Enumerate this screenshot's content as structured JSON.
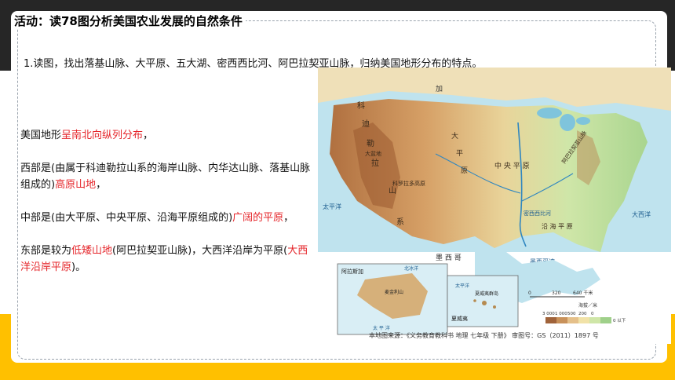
{
  "slide": {
    "title": "活动：读78图分析美国农业发展的自然条件",
    "question": "1.读图，找出落基山脉、大平原、五大湖、密西西比河、阿巴拉契亚山脉，归纳美国地形分布的特点。",
    "answer": {
      "p1": {
        "a": "美国地形",
        "b": "呈南北向纵列分布",
        "c": "，"
      },
      "p2": {
        "a": "西部是(由属于科迪勒拉山系的海岸山脉、内华达山脉、落基山脉组成的)",
        "b": "高原山地",
        "c": "，"
      },
      "p3": {
        "a": "中部是(由大平原、中央平原、沿海平原组成的)",
        "b": "广阔的平原",
        "c": "，"
      },
      "p4": {
        "a": "东部是较为",
        "b": "低矮山地",
        "c": "(阿巴拉契亚山脉)，大西洋沿岸为平原(",
        "d": "大西洋沿岸平原",
        "e": ")。"
      }
    }
  },
  "map": {
    "labels": {
      "canada": "加",
      "ke": "科",
      "di": "迪",
      "le": "勒",
      "la": "拉",
      "shan": "山",
      "xi": "系",
      "da": "大",
      "ping": "平",
      "yuan": "原",
      "central_plain": "中 央 平 原",
      "great_basin": "大盆地",
      "colorado": "科罗拉多高原",
      "appalachian": "阿巴拉契亚山脉",
      "mississippi": "密西西比河",
      "coastal_plain": "沿 海 平 原",
      "gulf": "墨西哥湾",
      "mexico": "墨 西 哥",
      "pacific": "太平洋",
      "atlantic": "大西洋"
    },
    "inset_alaska": {
      "title": "阿拉斯加",
      "peak": "麦金利山",
      "sea": "北冰洋",
      "pacific": "太 平 洋"
    },
    "inset_hawaii": {
      "title": "夏威夷",
      "islands": "夏威夷群岛",
      "sea": "太平洋"
    },
    "scale": {
      "ticks": [
        "0",
        "320",
        "640 千米"
      ]
    },
    "legend": {
      "title": "海拔／米",
      "ticks": [
        "3 000",
        "1 000",
        "500",
        "200",
        "0"
      ],
      "extra": "0 以下",
      "colors": [
        "#a0633a",
        "#c8915a",
        "#e5c08a",
        "#f1e2a8",
        "#cfe6a8",
        "#9fd08a"
      ]
    },
    "source": "本地图来源：《义务教育教科书 地理 七年级 下册》 审图号：GS（2011）1897 号"
  },
  "colors": {
    "band_top": "#262626",
    "band_bottom": "#ffc000",
    "highlight": "#e5252a"
  }
}
